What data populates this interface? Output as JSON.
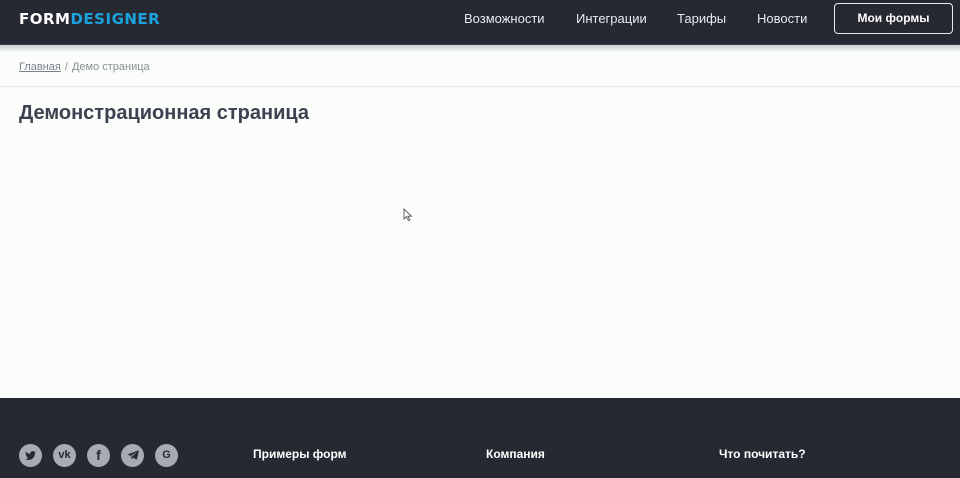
{
  "header": {
    "logo_part1": "FORM",
    "logo_part2": "DESIGNER",
    "nav": [
      {
        "label": "Возможности"
      },
      {
        "label": "Интеграции"
      },
      {
        "label": "Тарифы"
      },
      {
        "label": "Новости"
      }
    ],
    "my_forms_label": "Мои формы"
  },
  "breadcrumb": {
    "home": "Главная",
    "separator": "/",
    "current": "Демо страница"
  },
  "main": {
    "title": "Демонстрационная страница"
  },
  "footer": {
    "social": [
      {
        "icon": "twitter-icon",
        "glyph": ""
      },
      {
        "icon": "vk-icon",
        "glyph": "vk"
      },
      {
        "icon": "facebook-icon",
        "glyph": "f"
      },
      {
        "icon": "telegram-icon",
        "glyph": ""
      },
      {
        "icon": "google-icon",
        "glyph": "G"
      }
    ],
    "headings": [
      {
        "label": "Примеры форм"
      },
      {
        "label": "Компания"
      },
      {
        "label": "Что почитать?"
      }
    ]
  },
  "colors": {
    "header_bg": "#262832",
    "logo_accent": "#1aa3dd",
    "page_bg": "#fbfdfb",
    "title": "#3d4150",
    "social_icon_bg": "#a7abb2"
  }
}
